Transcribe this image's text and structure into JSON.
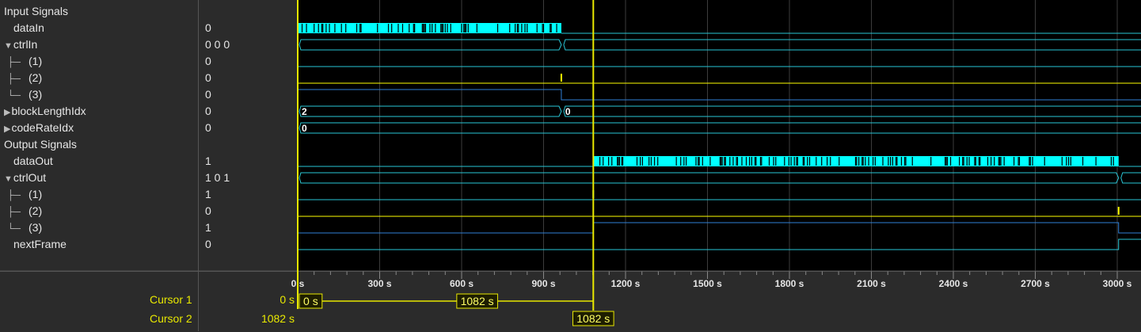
{
  "signals": [
    {
      "label": "Input Signals",
      "value": "",
      "kind": "group",
      "prefix": ""
    },
    {
      "label": "dataIn",
      "value": "0",
      "kind": "signal",
      "prefix": ""
    },
    {
      "label": "ctrlIn",
      "value": "0 0 0",
      "kind": "bus-expanded",
      "prefix": "▼"
    },
    {
      "label": "(1)",
      "value": "0",
      "kind": "child",
      "prefix": "├─"
    },
    {
      "label": "(2)",
      "value": "0",
      "kind": "child",
      "prefix": "├─"
    },
    {
      "label": "(3)",
      "value": "0",
      "kind": "child",
      "prefix": "└─"
    },
    {
      "label": "blockLengthIdx",
      "value": "0",
      "kind": "bus-collapsed",
      "prefix": "▶"
    },
    {
      "label": "codeRateIdx",
      "value": "0",
      "kind": "bus-collapsed",
      "prefix": "▶"
    },
    {
      "label": "Output Signals",
      "value": "",
      "kind": "group",
      "prefix": ""
    },
    {
      "label": "dataOut",
      "value": "1",
      "kind": "signal",
      "prefix": ""
    },
    {
      "label": "ctrlOut",
      "value": "1 0 1",
      "kind": "bus-expanded",
      "prefix": "▼"
    },
    {
      "label": "(1)",
      "value": "1",
      "kind": "child",
      "prefix": "├─"
    },
    {
      "label": "(2)",
      "value": "0",
      "kind": "child",
      "prefix": "├─"
    },
    {
      "label": "(3)",
      "value": "1",
      "kind": "child",
      "prefix": "└─"
    },
    {
      "label": "nextFrame",
      "value": "0",
      "kind": "signal",
      "prefix": ""
    }
  ],
  "axis": {
    "ticks": [
      "0 s",
      "300 s",
      "600 s",
      "900 s",
      "1200 s",
      "1500 s",
      "1800 s",
      "2100 s",
      "2400 s",
      "2700 s",
      "3000 s"
    ],
    "tick_values": [
      0,
      300,
      600,
      900,
      1200,
      1500,
      1800,
      2100,
      2400,
      2700,
      3000
    ],
    "range_s": [
      0,
      3100
    ]
  },
  "bus_labels": {
    "blockLengthIdx": [
      "2",
      "0"
    ],
    "codeRateIdx": [
      "0"
    ]
  },
  "cursors": [
    {
      "name": "Cursor 1",
      "time": "0 s",
      "time_s": 0
    },
    {
      "name": "Cursor 2",
      "time": "1082 s",
      "time_s": 1082
    }
  ],
  "delta_label": "1082 s",
  "colors": {
    "trace": "#29c6d6",
    "data": "#00ffff",
    "highlight": "#ffff00",
    "cursor": "#e8e800",
    "grid": "#3a3a3a",
    "panel": "#2b2b2b"
  }
}
